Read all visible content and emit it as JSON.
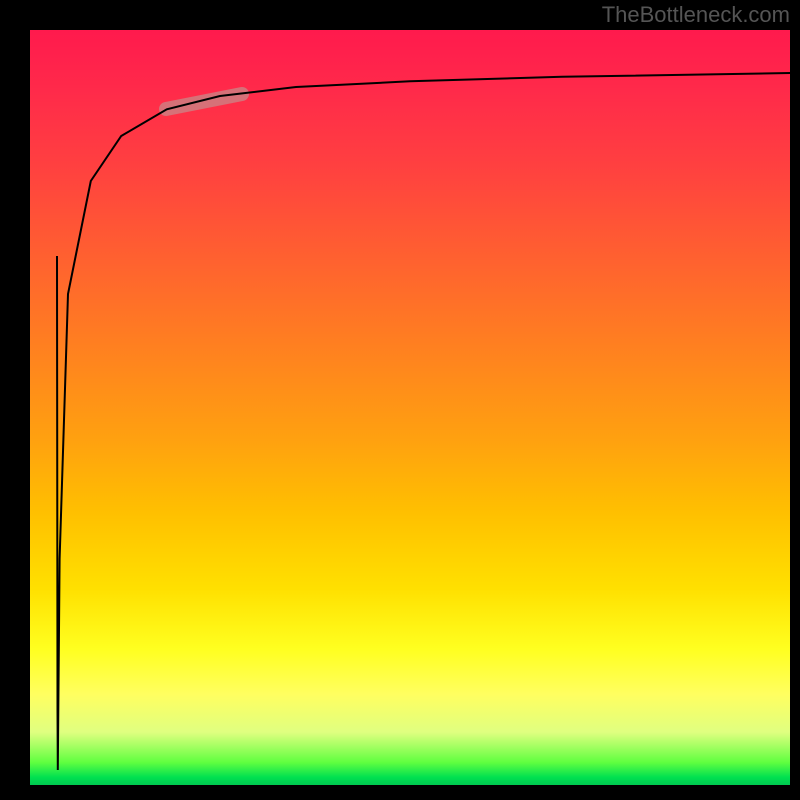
{
  "watermark": "TheBottleneck.com",
  "chart_data": {
    "type": "line",
    "title": "",
    "xlabel": "",
    "ylabel": "",
    "xlim": [
      0,
      100
    ],
    "ylim": [
      0,
      100
    ],
    "grid": false,
    "series": [
      {
        "name": "curve",
        "x": [
          3.5,
          3.6,
          3.65,
          3.9,
          5,
          8,
          12,
          18,
          25,
          35,
          50,
          70,
          100
        ],
        "y": [
          70,
          10,
          2,
          30,
          65,
          80,
          86,
          89.5,
          91.3,
          92.4,
          93.2,
          93.8,
          94.3
        ]
      }
    ],
    "highlight_region": {
      "x": [
        18,
        28
      ],
      "y": [
        89.5,
        91.5
      ]
    },
    "colors": {
      "gradient_top": "#ff1a4d",
      "gradient_bottom": "#00c850",
      "curve": "#000000",
      "highlight": "#c88888"
    }
  }
}
